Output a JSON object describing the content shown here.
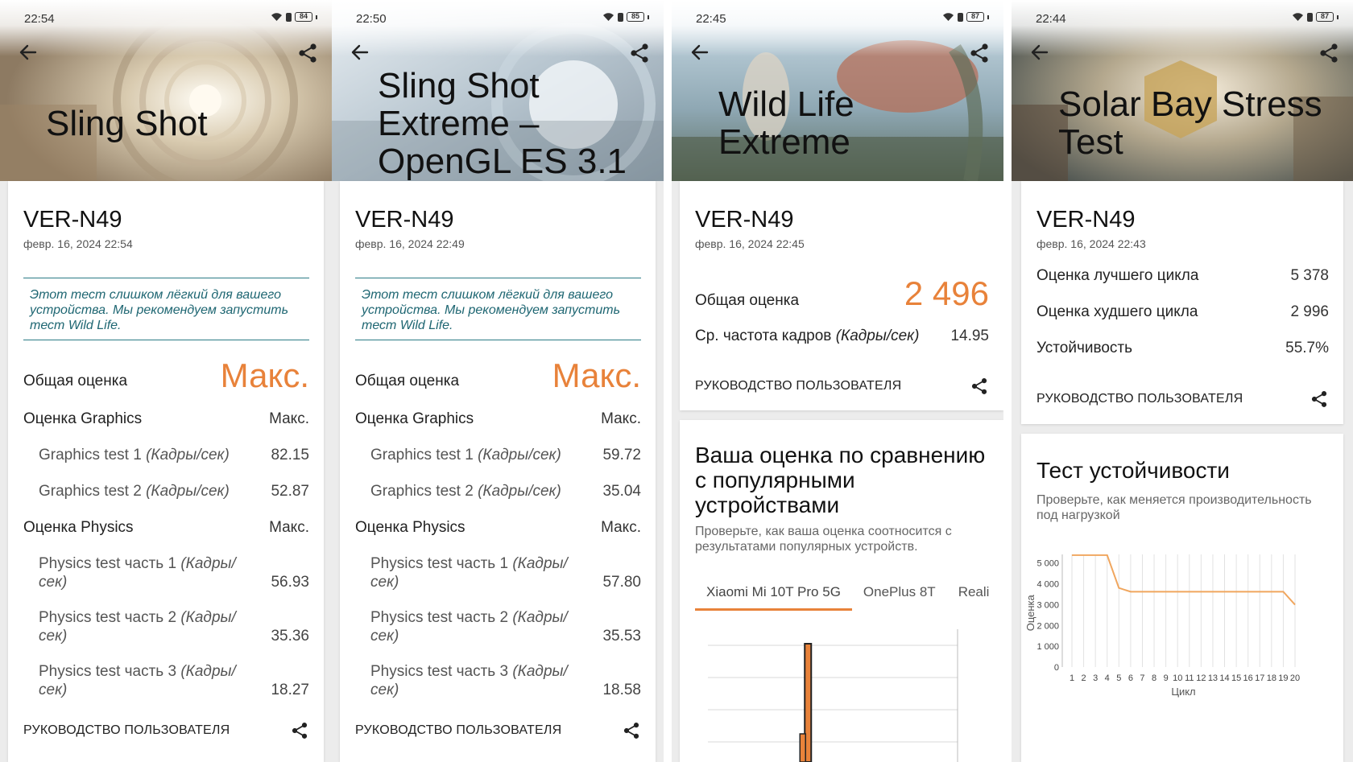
{
  "panels": [
    {
      "status": {
        "time": "22:54",
        "battery": "84"
      },
      "title_lines": [
        "Sling Shot"
      ],
      "device": "VER-N49",
      "date": "февр. 16, 2024 22:54",
      "notice": "Этот тест слишком лёгкий для вашего устройства. Мы рекомендуем запустить тест Wild Life.",
      "overall_label": "Общая оценка",
      "overall_value": "Макс.",
      "graphics_label": "Оценка Graphics",
      "graphics_value": "Макс.",
      "gt1_label": "Graphics test 1",
      "gt1_unit": "(Кадры/сек)",
      "gt1_value": "82.15",
      "gt2_label": "Graphics test 2",
      "gt2_unit": "(Кадры/сек)",
      "gt2_value": "52.87",
      "physics_label": "Оценка Physics",
      "physics_value": "Макс.",
      "pt1_label": "Physics test часть 1",
      "pt1_unit_a": "(Кадры/",
      "pt1_unit_b": "сек)",
      "pt1_value": "56.93",
      "pt2_label": "Physics test часть 2",
      "pt2_unit_a": "(Кадры/",
      "pt2_unit_b": "сек)",
      "pt2_value": "35.36",
      "pt3_label": "Physics test часть 3",
      "pt3_unit_a": "(Кадры/",
      "pt3_unit_b": "сек)",
      "pt3_value": "18.27",
      "guide": "РУКОВОДСТВО ПОЛЬЗОВАТЕЛЯ"
    },
    {
      "status": {
        "time": "22:50",
        "battery": "85"
      },
      "title_lines": [
        "Sling Shot",
        "Extreme –",
        "OpenGL ES 3.1"
      ],
      "device": "VER-N49",
      "date": "февр. 16, 2024 22:49",
      "notice": "Этот тест слишком лёгкий для вашего устройства. Мы рекомендуем запустить тест Wild Life.",
      "overall_label": "Общая оценка",
      "overall_value": "Макс.",
      "graphics_label": "Оценка Graphics",
      "graphics_value": "Макс.",
      "gt1_label": "Graphics test 1",
      "gt1_unit": "(Кадры/сек)",
      "gt1_value": "59.72",
      "gt2_label": "Graphics test 2",
      "gt2_unit": "(Кадры/сек)",
      "gt2_value": "35.04",
      "physics_label": "Оценка Physics",
      "physics_value": "Макс.",
      "pt1_label": "Physics test часть 1",
      "pt1_unit_a": "(Кадры/",
      "pt1_unit_b": "сек)",
      "pt1_value": "57.80",
      "pt2_label": "Physics test часть 2",
      "pt2_unit_a": "(Кадры/",
      "pt2_unit_b": "сек)",
      "pt2_value": "35.53",
      "pt3_label": "Physics test часть 3",
      "pt3_unit_a": "(Кадры/",
      "pt3_unit_b": "сек)",
      "pt3_value": "18.58",
      "guide": "РУКОВОДСТВО ПОЛЬЗОВАТЕЛЯ"
    },
    {
      "status": {
        "time": "22:45",
        "battery": "87"
      },
      "title_lines": [
        "Wild Life",
        "Extreme"
      ],
      "device": "VER-N49",
      "date": "февр. 16, 2024 22:45",
      "overall_label": "Общая оценка",
      "overall_value": "2 496",
      "fps_label": "Ср. частота кадров",
      "fps_unit": "(Кадры/сек)",
      "fps_value": "14.95",
      "guide": "РУКОВОДСТВО ПОЛЬЗОВАТЕЛЯ",
      "compare_title": "Ваша оценка по сравнению с популярными устройствами",
      "compare_sub": "Проверьте, как ваша оценка соотносится с результатами популярных устройств.",
      "tabs": [
        "Xiaomi Mi 10T Pro 5G",
        "OnePlus 8T",
        "Reali"
      ]
    },
    {
      "status": {
        "time": "22:44",
        "battery": "87"
      },
      "title_lines": [
        "Solar Bay Stress",
        "Test"
      ],
      "device": "VER-N49",
      "date": "февр. 16, 2024 22:43",
      "best_label": "Оценка лучшего цикла",
      "best_value": "5 378",
      "worst_label": "Оценка худшего цикла",
      "worst_value": "2 996",
      "stability_label": "Устойчивость",
      "stability_value": "55.7%",
      "guide": "РУКОВОДСТВО ПОЛЬЗОВАТЕЛЯ",
      "stress_title": "Тест устойчивости",
      "stress_sub": "Проверьте, как меняется производительность под нагрузкой"
    }
  ],
  "colors": {
    "accent": "#e8823a",
    "notice": "#1e6672",
    "notice_border": "#2a7a85"
  },
  "chart_data": [
    {
      "type": "bar",
      "title": "",
      "xlabel": "",
      "ylabel": "",
      "note": "distribution histogram, values unreadable; single visible tall bar with marker",
      "values": [
        0,
        0,
        0,
        1,
        0,
        0,
        0,
        0
      ],
      "grid": true
    },
    {
      "type": "line",
      "title": "",
      "xlabel": "Цикл",
      "ylabel": "Оценка",
      "x": [
        1,
        2,
        3,
        4,
        5,
        6,
        7,
        8,
        9,
        10,
        11,
        12,
        13,
        14,
        15,
        16,
        17,
        18,
        19,
        20
      ],
      "series": [
        {
          "values": [
            5378,
            5378,
            5378,
            5378,
            3800,
            3620,
            3620,
            3620,
            3620,
            3620,
            3620,
            3620,
            3620,
            3620,
            3620,
            3620,
            3620,
            3620,
            3620,
            2996
          ]
        }
      ],
      "yticks": [
        "0",
        "1 000",
        "2 000",
        "3 000",
        "4 000",
        "5 000"
      ],
      "ylim": [
        0,
        5800
      ],
      "grid": true
    }
  ]
}
